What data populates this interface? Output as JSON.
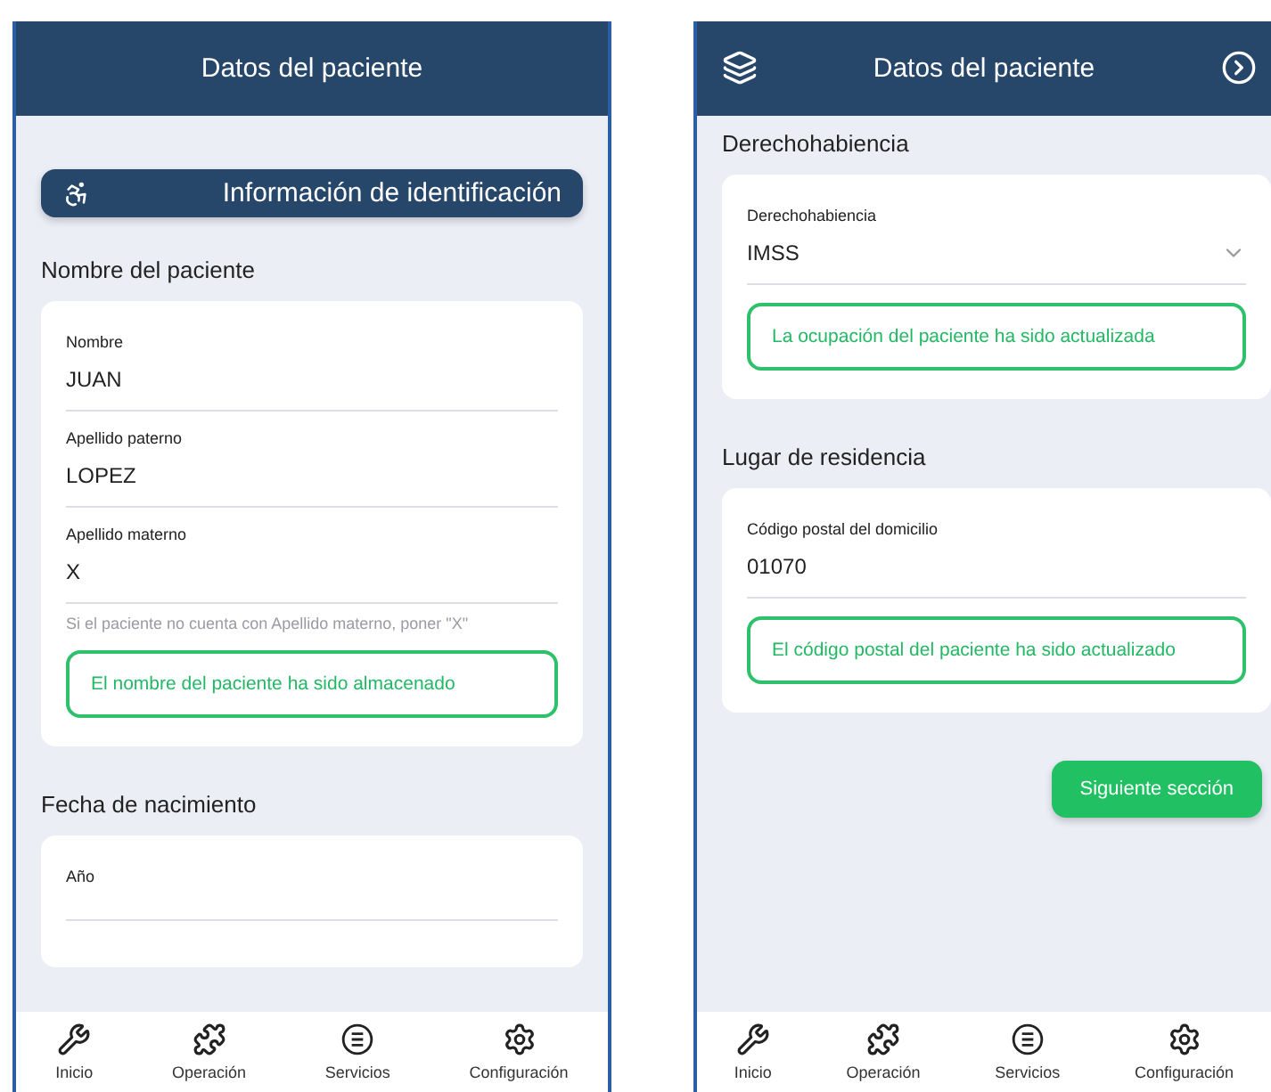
{
  "screens": [
    {
      "header": {
        "title": "Datos del paciente",
        "side_buttons": false
      },
      "cut": false,
      "blocks": [
        {
          "kind": "banner",
          "text": "Información de identificación"
        },
        {
          "kind": "heading",
          "text": "Nombre del paciente"
        },
        {
          "kind": "card",
          "fields": [
            {
              "kind": "text",
              "label": "Nombre",
              "value": "JUAN"
            },
            {
              "kind": "text",
              "label": "Apellido paterno",
              "value": "LOPEZ"
            },
            {
              "kind": "text",
              "label": "Apellido materno",
              "value": "X",
              "hint": "Si el paciente no cuenta con Apellido materno, poner \"X\""
            }
          ],
          "notice": "El nombre del paciente ha sido almacenado"
        },
        {
          "kind": "heading",
          "text": "Fecha de nacimiento"
        },
        {
          "kind": "card",
          "fields": [
            {
              "kind": "text",
              "label": "Año"
            }
          ]
        }
      ],
      "nav": [
        {
          "label": "Inicio"
        },
        {
          "label": "Operación"
        },
        {
          "label": "Servicios"
        },
        {
          "label": "Configuración"
        }
      ]
    },
    {
      "header": {
        "title": "Datos del paciente",
        "side_buttons": true
      },
      "cut": true,
      "blocks": [
        {
          "kind": "heading",
          "text": "Derechohabiencia"
        },
        {
          "kind": "card",
          "fields": [
            {
              "kind": "select",
              "label": "Derechohabiencia",
              "value": "IMSS"
            }
          ],
          "notice": "La ocupación del paciente ha sido actualizada"
        },
        {
          "kind": "heading",
          "text": "Lugar de residencia"
        },
        {
          "kind": "card",
          "fields": [
            {
              "kind": "text",
              "label": "Código postal del domicilio",
              "value": "01070"
            }
          ],
          "notice": "El código postal del paciente ha sido actualizado"
        },
        {
          "kind": "button",
          "text": "Siguiente sección"
        }
      ],
      "nav": [
        {
          "label": "Inicio"
        },
        {
          "label": "Operación"
        },
        {
          "label": "Servicios"
        },
        {
          "label": "Configuración"
        }
      ]
    }
  ]
}
